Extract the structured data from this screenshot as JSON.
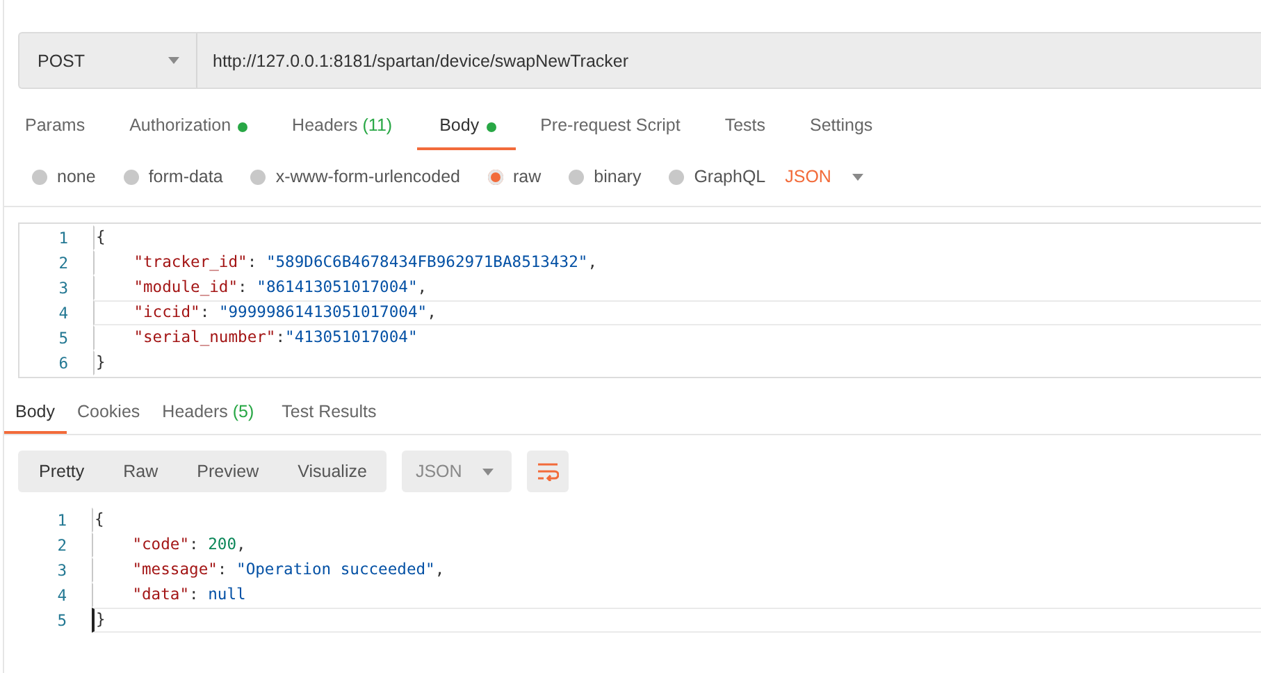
{
  "request": {
    "method": "POST",
    "url": "http://127.0.0.1:8181/spartan/device/swapNewTracker"
  },
  "tabs": [
    {
      "label": "Params",
      "selected": false,
      "dot": false
    },
    {
      "label": "Authorization",
      "selected": false,
      "dot": true
    },
    {
      "label": "Headers",
      "count": "(11)",
      "selected": false,
      "dot": false
    },
    {
      "label": "Body",
      "selected": true,
      "dot": true
    },
    {
      "label": "Pre-request Script",
      "selected": false,
      "dot": false
    },
    {
      "label": "Tests",
      "selected": false,
      "dot": false
    },
    {
      "label": "Settings",
      "selected": false,
      "dot": false
    }
  ],
  "body_types": [
    {
      "label": "none",
      "selected": false
    },
    {
      "label": "form-data",
      "selected": false
    },
    {
      "label": "x-www-form-urlencoded",
      "selected": false
    },
    {
      "label": "raw",
      "selected": true
    },
    {
      "label": "binary",
      "selected": false
    },
    {
      "label": "GraphQL",
      "selected": false
    }
  ],
  "raw_format": "JSON",
  "request_body": [
    {
      "number": "1",
      "current": false,
      "tokens": [
        {
          "kind": "punct",
          "text": "{"
        }
      ]
    },
    {
      "number": "2",
      "current": false,
      "tokens": [
        {
          "kind": "key",
          "text": "    \"tracker_id\""
        },
        {
          "kind": "punct",
          "text": ": "
        },
        {
          "kind": "string",
          "text": "\"589D6C6B4678434FB962971BA8513432\""
        },
        {
          "kind": "punct",
          "text": ","
        }
      ]
    },
    {
      "number": "3",
      "current": false,
      "tokens": [
        {
          "kind": "key",
          "text": "    \"module_id\""
        },
        {
          "kind": "punct",
          "text": ": "
        },
        {
          "kind": "string",
          "text": "\"861413051017004\""
        },
        {
          "kind": "punct",
          "text": ","
        }
      ]
    },
    {
      "number": "4",
      "current": true,
      "tokens": [
        {
          "kind": "key",
          "text": "    \"iccid\""
        },
        {
          "kind": "punct",
          "text": ": "
        },
        {
          "kind": "string",
          "text": "\"99999861413051017004\""
        },
        {
          "kind": "punct",
          "text": ","
        }
      ]
    },
    {
      "number": "5",
      "current": false,
      "tokens": [
        {
          "kind": "key",
          "text": "    \"serial_number\""
        },
        {
          "kind": "punct",
          "text": ":"
        },
        {
          "kind": "string",
          "text": "\"413051017004\""
        }
      ]
    },
    {
      "number": "6",
      "current": false,
      "tokens": [
        {
          "kind": "punct",
          "text": "}"
        }
      ]
    }
  ],
  "response_tabs": [
    {
      "label": "Body",
      "selected": true
    },
    {
      "label": "Cookies",
      "selected": false
    },
    {
      "label": "Headers",
      "count": "(5)",
      "selected": false
    },
    {
      "label": "Test Results",
      "selected": false
    }
  ],
  "view_modes": [
    {
      "label": "Pretty",
      "selected": true
    },
    {
      "label": "Raw",
      "selected": false
    },
    {
      "label": "Preview",
      "selected": false
    },
    {
      "label": "Visualize",
      "selected": false
    }
  ],
  "response_format": "JSON",
  "response_body": [
    {
      "number": "1",
      "current": false,
      "tokens": [
        {
          "kind": "punct",
          "text": "{"
        }
      ]
    },
    {
      "number": "2",
      "current": false,
      "tokens": [
        {
          "kind": "key",
          "text": "    \"code\""
        },
        {
          "kind": "punct",
          "text": ": "
        },
        {
          "kind": "number",
          "text": "200"
        },
        {
          "kind": "punct",
          "text": ","
        }
      ]
    },
    {
      "number": "3",
      "current": false,
      "tokens": [
        {
          "kind": "key",
          "text": "    \"message\""
        },
        {
          "kind": "punct",
          "text": ": "
        },
        {
          "kind": "string",
          "text": "\"Operation succeeded\""
        },
        {
          "kind": "punct",
          "text": ","
        }
      ]
    },
    {
      "number": "4",
      "current": false,
      "tokens": [
        {
          "kind": "key",
          "text": "    \"data\""
        },
        {
          "kind": "punct",
          "text": ": "
        },
        {
          "kind": "null",
          "text": "null"
        }
      ]
    },
    {
      "number": "5",
      "current": true,
      "tokens": [
        {
          "kind": "punct",
          "text": "}"
        }
      ]
    }
  ]
}
